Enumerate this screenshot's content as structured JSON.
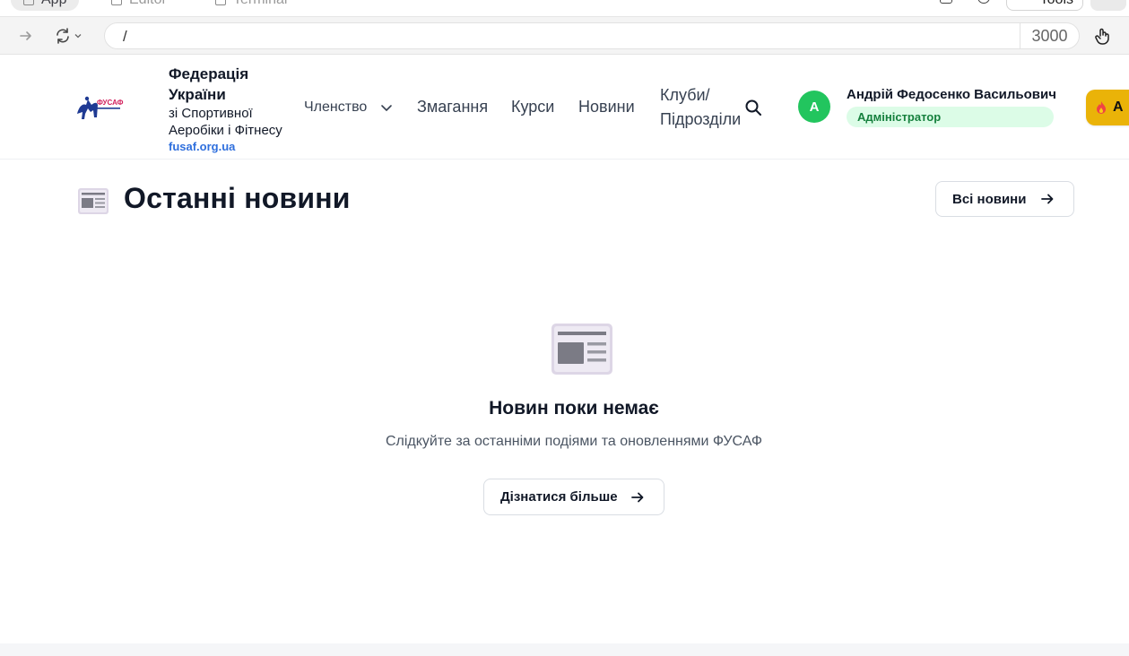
{
  "browser": {
    "tabs": [
      "App",
      "Editor",
      "Terminal"
    ],
    "tools_label": "Tools",
    "url": "/",
    "port": "3000"
  },
  "header": {
    "org_name_line1": "Федерація України",
    "org_name_line2": "зі Спортивної Аеробіки і Фітнесу",
    "org_site": "fusaf.org.ua",
    "nav": {
      "membership": "Членство",
      "competitions": "Змагання",
      "courses": "Курси",
      "news": "Новини",
      "clubs_line1": "Клуби/",
      "clubs_line2": "Підрозділи"
    },
    "user": {
      "avatar_letter": "А",
      "name": "Андрій Федосенко Васильович",
      "role": "Адміністратор"
    },
    "cta_label": "А"
  },
  "section": {
    "title": "Останні новини",
    "all_news_label": "Всі новини",
    "empty_title": "Новин поки немає",
    "empty_subtitle": "Слідкуйте за останніми подіями та оновленнями ФУСАФ",
    "learn_more_label": "Дізнатися більше"
  },
  "colors": {
    "accent_green": "#22c55e",
    "badge_bg": "#dcfce7",
    "badge_text": "#15803d",
    "cta_yellow": "#eab308",
    "link_blue": "#2f6fdd"
  }
}
